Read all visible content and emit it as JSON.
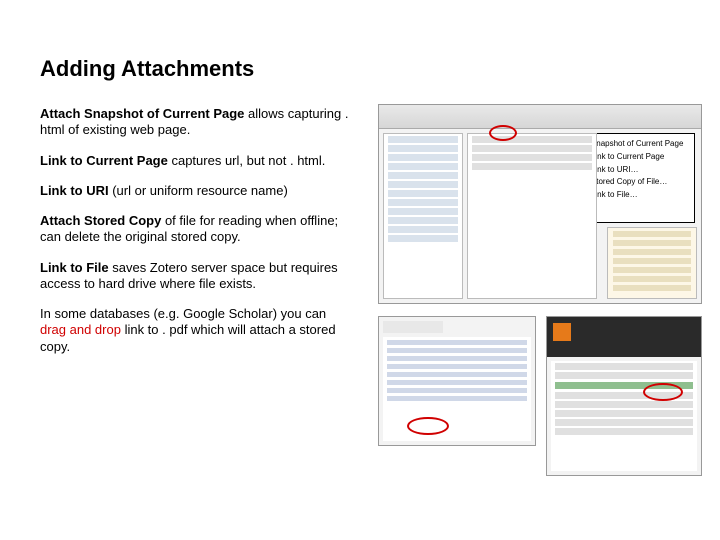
{
  "title": "Adding Attachments",
  "paragraphs": {
    "p1_bold": "Attach Snapshot of Current Page",
    "p1_rest": " allows capturing . html of existing web page.",
    "p2_bold": "Link to Current Page",
    "p2_rest": " captures url, but not . html.",
    "p3_bold": "Link to URI",
    "p3_rest": " (url or uniform resource name)",
    "p4_bold": "Attach Stored Copy",
    "p4_rest": " of file for reading when offline; can delete the original stored copy.",
    "p5_bold": "Link to File",
    "p5_rest": " saves Zotero server space but requires access to hard drive where file exists.",
    "p6_pre": "In some databases (e.g. Google Scholar) you can ",
    "p6_red": "drag and drop",
    "p6_post": " link to . pdf which will attach a stored copy."
  },
  "menu": {
    "item1": "Attach Snapshot of Current Page",
    "item2": "Attach Link to Current Page",
    "item3": "Attach Link to URI…",
    "item4": "Attach Stored Copy of File…",
    "item5": "Attach Link to File…"
  }
}
